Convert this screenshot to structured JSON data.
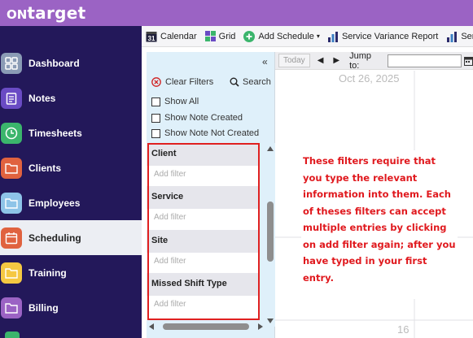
{
  "app": {
    "logo_on": "ON",
    "logo_target": "target"
  },
  "sidebar": {
    "items": [
      {
        "label": "Dashboard",
        "icon": "grid-icon",
        "color": "#8a9bb5"
      },
      {
        "label": "Notes",
        "icon": "notepad-icon",
        "color": "#6a4bc4"
      },
      {
        "label": "Timesheets",
        "icon": "clock-icon",
        "color": "#3bb56c"
      },
      {
        "label": "Clients",
        "icon": "folder-icon",
        "color": "#e0623f"
      },
      {
        "label": "Employees",
        "icon": "folder-icon",
        "color": "#8ec4e8"
      },
      {
        "label": "Scheduling",
        "icon": "calendar-icon",
        "color": "#e0623f"
      },
      {
        "label": "Training",
        "icon": "folder-icon",
        "color": "#f5c842"
      },
      {
        "label": "Billing",
        "icon": "folder-icon",
        "color": "#9b63c4"
      }
    ],
    "active": "Scheduling"
  },
  "toolbar": {
    "calendar": "Calendar",
    "calendar_icon_text": "31",
    "grid": "Grid",
    "add_schedule": "Add Schedule",
    "service_variance_report": "Service Variance Report",
    "truncated": "Serv"
  },
  "filters": {
    "clear_filters": "Clear Filters",
    "search": "Search",
    "show_all": "Show All",
    "show_note_created": "Show Note Created",
    "show_note_not_created": "Show Note Not Created",
    "sections": [
      {
        "label": "Client",
        "placeholder": "Add filter"
      },
      {
        "label": "Service",
        "placeholder": "Add filter"
      },
      {
        "label": "Site",
        "placeholder": "Add filter"
      },
      {
        "label": "Missed Shift Type",
        "placeholder": "Add filter"
      }
    ]
  },
  "calendar": {
    "today": "Today",
    "jump_to": "Jump to:",
    "date_header": "Oct 26, 2025",
    "day_number": "16"
  },
  "annotation": {
    "text": "These filters require that you type the relevant information into them. Each of theses filters can accept multiple entries by clicking on add filter again; after you have typed in your first entry."
  },
  "colors": {
    "top_bar": "#9b63c4",
    "sidebar": "#23185a",
    "filter_panel": "#dff0fa",
    "highlight_box": "#e02020",
    "annotation_text": "#e0191e"
  }
}
